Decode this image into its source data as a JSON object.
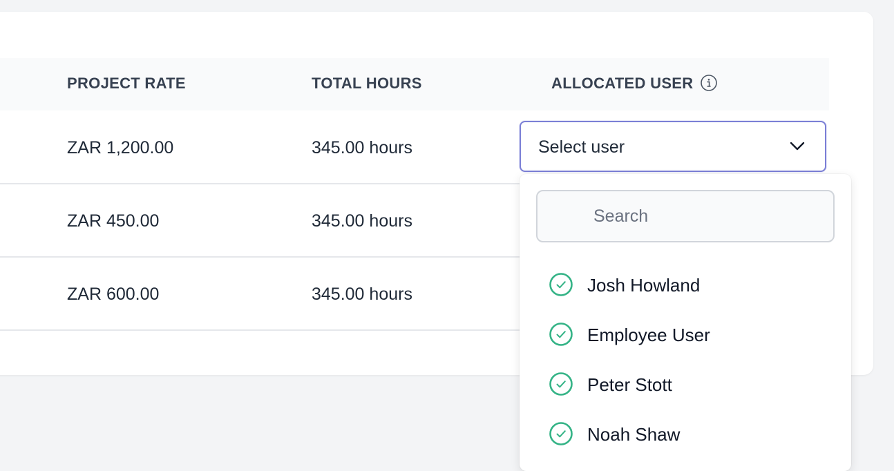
{
  "table": {
    "headers": {
      "project_rate": "PROJECT RATE",
      "total_hours": "TOTAL HOURS",
      "allocated_user": "ALLOCATED USER"
    },
    "rows": [
      {
        "rate": "ZAR 1,200.00",
        "hours": "345.00 hours"
      },
      {
        "rate": "ZAR 450.00",
        "hours": "345.00 hours"
      },
      {
        "rate": "ZAR 600.00",
        "hours": "345.00 hours"
      }
    ]
  },
  "user_select": {
    "value": "Select user",
    "icon": "chevron-down-icon"
  },
  "dropdown": {
    "search_placeholder": "Search",
    "options": [
      {
        "label": "Josh Howland",
        "icon": "check-circle-icon"
      },
      {
        "label": "Employee User",
        "icon": "check-circle-icon"
      },
      {
        "label": "Peter Stott",
        "icon": "check-circle-icon"
      },
      {
        "label": "Noah Shaw",
        "icon": "check-circle-icon"
      }
    ]
  },
  "colors": {
    "background": "#f3f4f6",
    "card": "#ffffff",
    "header_bg": "#f9fafb",
    "focus_border": "#7b7fd6",
    "check": "#34b386"
  }
}
